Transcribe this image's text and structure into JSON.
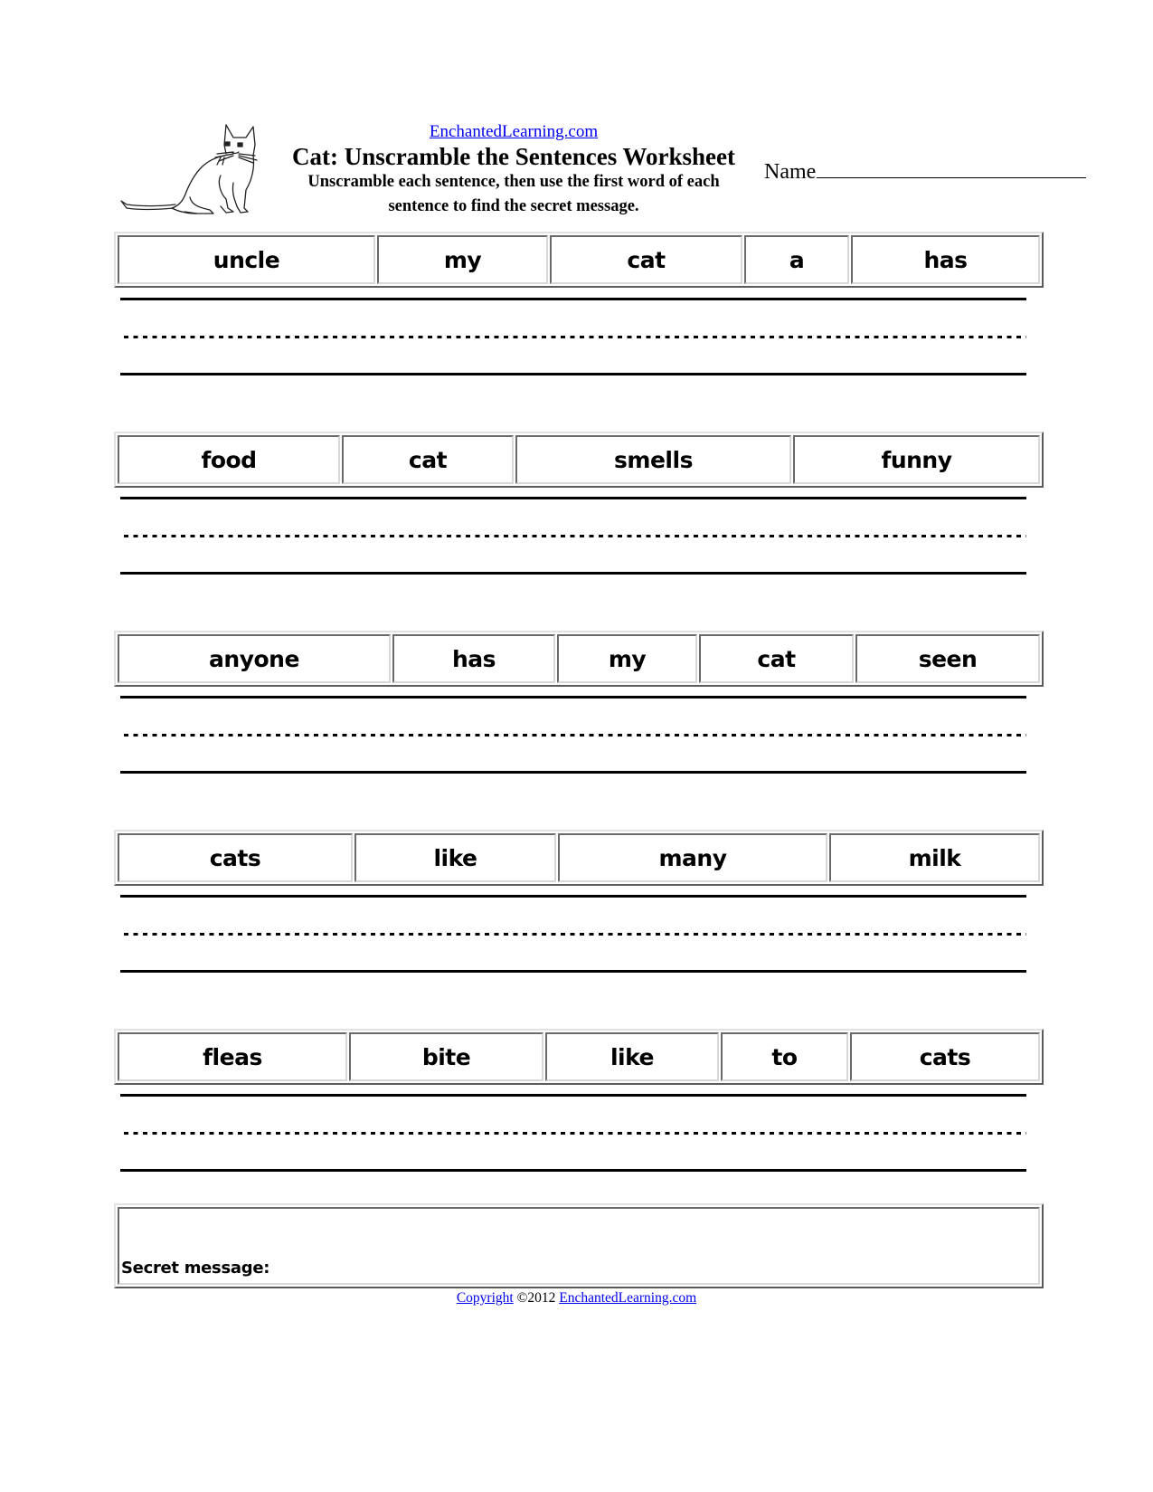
{
  "header": {
    "site_link": "EnchantedLearning.com",
    "title": "Cat: Unscramble the Sentences Worksheet",
    "instructions_line1": "Unscramble each sentence, then use the first word of each",
    "instructions_line2": "sentence to find the secret message.",
    "name_label": "Name",
    "illustration": "cat-drawing"
  },
  "sentences": [
    {
      "words": [
        "uncle",
        "my",
        "cat",
        "a",
        "has"
      ]
    },
    {
      "words": [
        "food",
        "cat",
        "smells",
        "funny"
      ]
    },
    {
      "words": [
        "anyone",
        "has",
        "my",
        "cat",
        "seen"
      ]
    },
    {
      "words": [
        "cats",
        "like",
        "many",
        "milk"
      ]
    },
    {
      "words": [
        "fleas",
        "bite",
        "like",
        "to",
        "cats"
      ]
    }
  ],
  "secret_message": {
    "label": "Secret message:",
    "value": ""
  },
  "footer": {
    "copyright_link": "Copyright",
    "year_text": "©2012",
    "site_link": "EnchantedLearning.com"
  },
  "colors": {
    "link": "#0000ee",
    "text": "#000000",
    "border_light": "#e2e2e2",
    "border_dark": "#5a5a5a"
  }
}
